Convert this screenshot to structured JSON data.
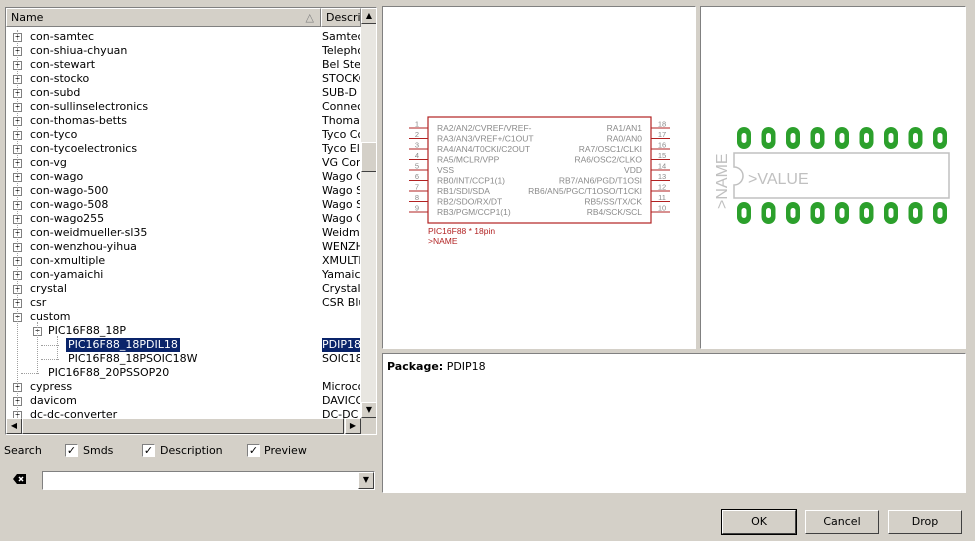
{
  "tree": {
    "columns": {
      "name": "Name",
      "description": "Descript"
    },
    "rows": [
      {
        "name": "con-samtec",
        "desc": "Samtec"
      },
      {
        "name": "con-shiua-chyuan",
        "desc": "Telepho"
      },
      {
        "name": "con-stewart",
        "desc": "Bel Stev"
      },
      {
        "name": "con-stocko",
        "desc": "STOCKO"
      },
      {
        "name": "con-subd",
        "desc": "SUB-D C"
      },
      {
        "name": "con-sullinselectronics",
        "desc": "Connect"
      },
      {
        "name": "con-thomas-betts",
        "desc": "Thomas"
      },
      {
        "name": "con-tyco",
        "desc": "Tyco Co"
      },
      {
        "name": "con-tycoelectronics",
        "desc": "Tyco Ele"
      },
      {
        "name": "con-vg",
        "desc": "VG Conn"
      },
      {
        "name": "con-wago",
        "desc": "Wago C"
      },
      {
        "name": "con-wago-500",
        "desc": "Wago S"
      },
      {
        "name": "con-wago-508",
        "desc": "Wago S"
      },
      {
        "name": "con-wago255",
        "desc": "Wago C"
      },
      {
        "name": "con-weidmueller-sl35",
        "desc": "Weidmu"
      },
      {
        "name": "con-wenzhou-yihua",
        "desc": "WENZHO"
      },
      {
        "name": "con-xmultiple",
        "desc": "XMULTIF"
      },
      {
        "name": "con-yamaichi",
        "desc": "Yamaich"
      },
      {
        "name": "crystal",
        "desc": "Crystals"
      },
      {
        "name": "csr",
        "desc": "CSR Blu"
      },
      {
        "name": "custom",
        "desc": ""
      },
      {
        "name": "PIC16F88_18P",
        "desc": ""
      },
      {
        "name": "PIC16F88_18PDIL18",
        "desc": "PDIP18"
      },
      {
        "name": "PIC16F88_18PSOIC18W",
        "desc": "SOIC18"
      },
      {
        "name": "PIC16F88_20PSSOP20",
        "desc": ""
      },
      {
        "name": "cypress",
        "desc": "Microcor"
      },
      {
        "name": "davicom",
        "desc": "DAVICO"
      },
      {
        "name": "dc-dc-converter",
        "desc": "DC-DC C"
      }
    ]
  },
  "options": {
    "search_label": "Search",
    "smds_label": "Smds",
    "description_label": "Description",
    "preview_label": "Preview",
    "smds_checked": "✓",
    "description_checked": "✓",
    "preview_checked": "✓"
  },
  "schematic": {
    "left_pins": [
      {
        "num": "1",
        "name": "RA2/AN2/CVREF/VREF-"
      },
      {
        "num": "2",
        "name": "RA3/AN3/VREF+/C1OUT"
      },
      {
        "num": "3",
        "name": "RA4/AN4/T0CKI/C2OUT"
      },
      {
        "num": "4",
        "name": "RA5/MCLR/VPP"
      },
      {
        "num": "5",
        "name": "VSS"
      },
      {
        "num": "6",
        "name": "RB0/INT/CCP1(1)"
      },
      {
        "num": "7",
        "name": "RB1/SDI/SDA"
      },
      {
        "num": "8",
        "name": "RB2/SDO/RX/DT"
      },
      {
        "num": "9",
        "name": "RB3/PGM/CCP1(1)"
      }
    ],
    "right_pins": [
      {
        "num": "18",
        "name": "RA1/AN1"
      },
      {
        "num": "17",
        "name": "RA0/AN0"
      },
      {
        "num": "16",
        "name": "RA7/OSC1/CLKI"
      },
      {
        "num": "15",
        "name": "RA6/OSC2/CLKO"
      },
      {
        "num": "14",
        "name": "VDD"
      },
      {
        "num": "13",
        "name": "RB7/AN6/PGD/T1OSI"
      },
      {
        "num": "12",
        "name": "RB6/AN5/PGC/T1OSO/T1CKI"
      },
      {
        "num": "11",
        "name": "RB5/SS/TX/CK"
      },
      {
        "num": "10",
        "name": "RB4/SCK/SCL"
      }
    ],
    "part_label": "PIC16F88 * 18pin",
    "name_label": ">NAME"
  },
  "package_preview": {
    "name_label": ">NAME",
    "value_label": ">VALUE",
    "pad_color": "#2ca02c"
  },
  "info": {
    "package_label": "Package:",
    "package_value": "PDIP18"
  },
  "buttons": {
    "ok": "OK",
    "cancel": "Cancel",
    "drop": "Drop"
  },
  "colors": {
    "selection": "#0a246a",
    "schematic_line": "#b22222",
    "schematic_text": "#8a8a8a"
  }
}
